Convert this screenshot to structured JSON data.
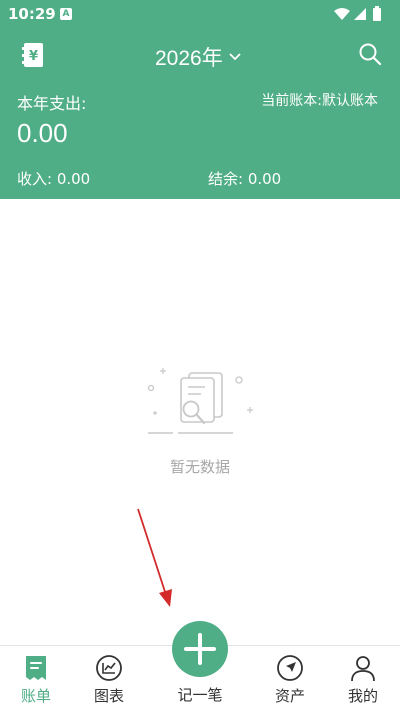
{
  "status_bar": {
    "time": "10:29",
    "notification_letter": "A"
  },
  "header": {
    "year": "2026年",
    "year_expense_label": "本年支出:",
    "current_book": "当前账本:默认账本",
    "expense_amount": "0.00",
    "income_label": "收入: 0.00",
    "balance_label": "结余: 0.00"
  },
  "empty_state": {
    "text": "暂无数据"
  },
  "bottom_nav": {
    "items": [
      {
        "label": "账单",
        "icon": "bill-icon",
        "active": true
      },
      {
        "label": "图表",
        "icon": "chart-icon",
        "active": false
      },
      {
        "label": "记一笔",
        "icon": "plus-icon",
        "active": false
      },
      {
        "label": "资产",
        "icon": "compass-icon",
        "active": false
      },
      {
        "label": "我的",
        "icon": "person-icon",
        "active": false
      }
    ]
  },
  "colors": {
    "primary": "#4fae86",
    "annotation_arrow": "#d32a2a",
    "empty_text": "#a7a7a7"
  }
}
